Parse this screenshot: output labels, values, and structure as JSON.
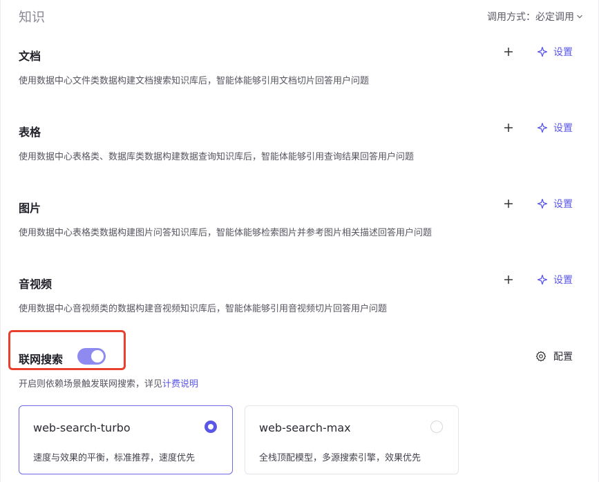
{
  "header": {
    "title": "知识",
    "mode_label": "调用方式：",
    "mode_value": "必定调用"
  },
  "sections": [
    {
      "name": "文档",
      "desc": "使用数据中心文件类数据构建文档搜索知识库后，智能体能够引用文档切片回答用户问题",
      "settings_label": "设置"
    },
    {
      "name": "表格",
      "desc": "使用数据中心表格类、数据库类数据构建数据查询知识库后，智能体能够引用查询结果回答用户问题",
      "settings_label": "设置"
    },
    {
      "name": "图片",
      "desc": "使用数据中心表格类数据构建图片问答知识库后，智能体能够检索图片并参考图片相关描述回答用户问题",
      "settings_label": "设置"
    },
    {
      "name": "音视频",
      "desc": "使用数据中心音视频类的数据构建音视频知识库后，智能体能够引用音视频切片回答用户问题",
      "settings_label": "设置"
    }
  ],
  "web_search": {
    "name": "联网搜索",
    "enabled": true,
    "configure_label": "配置",
    "desc_prefix": "开启则依赖场景触发联网搜索，详见",
    "desc_link": "计费说明",
    "models": [
      {
        "name": "web-search-turbo",
        "desc": "速度与效果的平衡，标准推荐，速度优先",
        "selected": true
      },
      {
        "name": "web-search-max",
        "desc": "全栈顶配模型，多源搜索引擎，效果优先",
        "selected": false
      }
    ]
  },
  "colors": {
    "accent": "#5b57e6",
    "toggle_on": "#8e8af0",
    "highlight_box": "#e8402c"
  }
}
